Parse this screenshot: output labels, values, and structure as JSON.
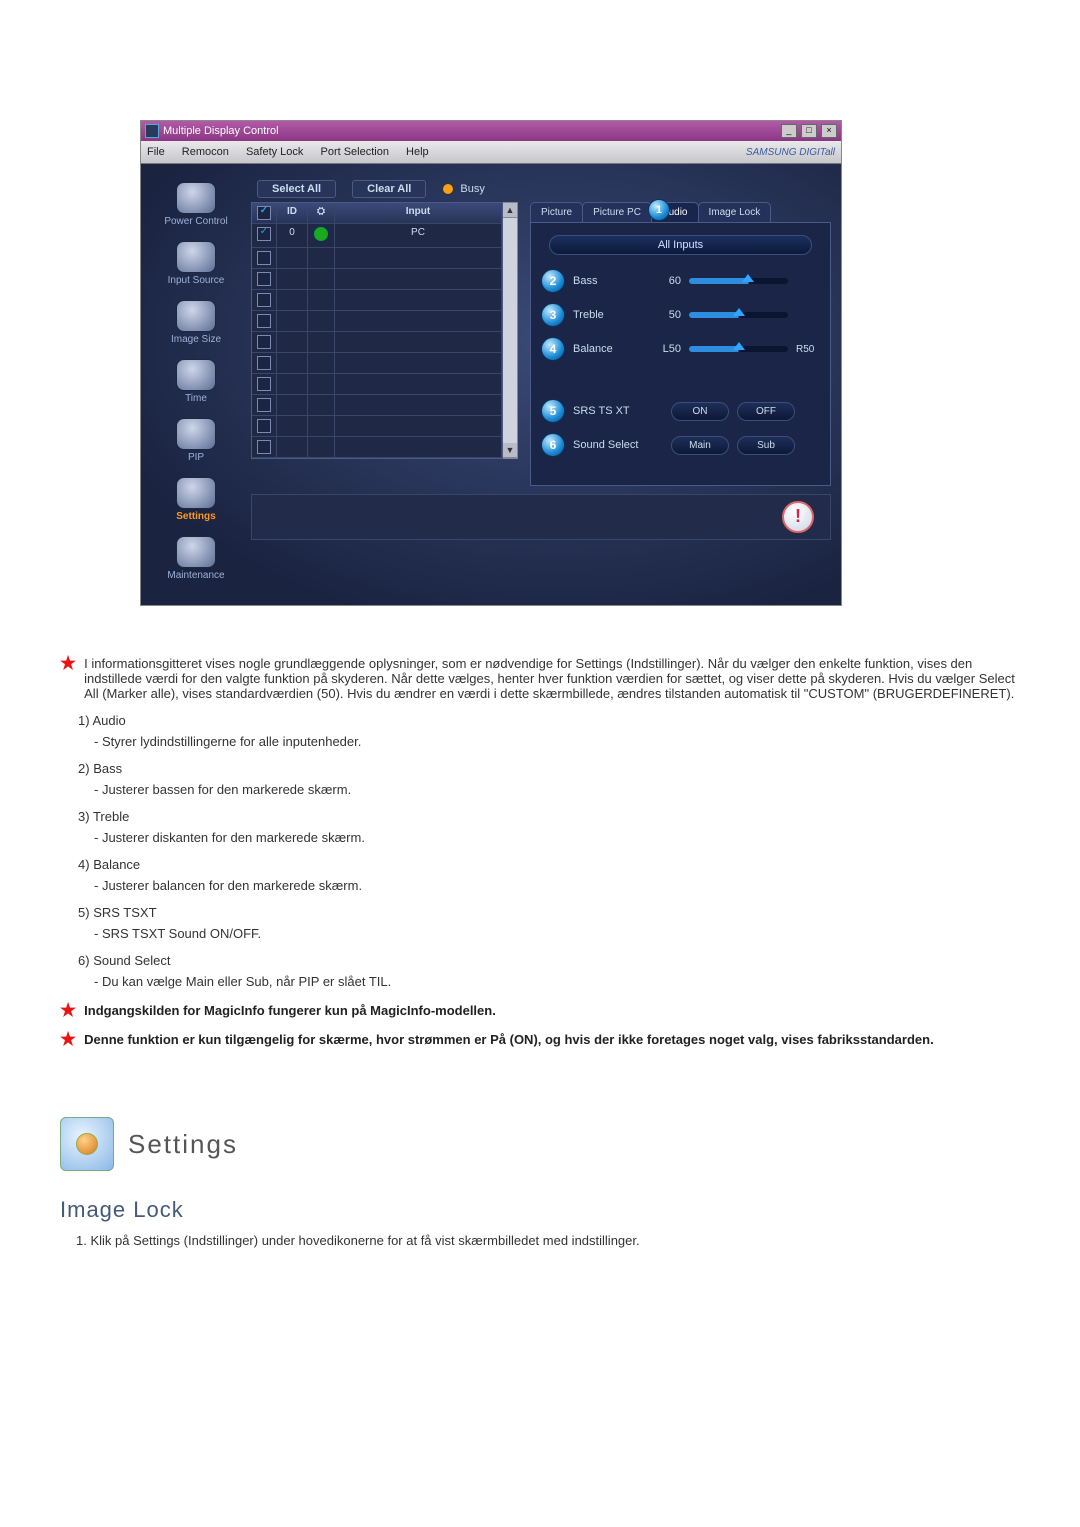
{
  "screenshot": {
    "window_title": "Multiple Display Control",
    "menu": [
      "File",
      "Remocon",
      "Safety Lock",
      "Port Selection",
      "Help"
    ],
    "brand": "SAMSUNG DIGITall",
    "sidebar": [
      {
        "label": "Power Control",
        "active": false
      },
      {
        "label": "Input Source",
        "active": false
      },
      {
        "label": "Image Size",
        "active": false
      },
      {
        "label": "Time",
        "active": false
      },
      {
        "label": "PIP",
        "active": false
      },
      {
        "label": "Settings",
        "active": true
      },
      {
        "label": "Maintenance",
        "active": false
      }
    ],
    "toolbar": {
      "select_all": "Select All",
      "clear_all": "Clear All",
      "busy": "Busy"
    },
    "grid": {
      "headers": {
        "id": "ID",
        "input": "Input"
      },
      "rows": [
        {
          "checked": true,
          "id": "0",
          "status": "on",
          "input": "PC"
        },
        {
          "checked": false
        },
        {
          "checked": false
        },
        {
          "checked": false
        },
        {
          "checked": false
        },
        {
          "checked": false
        },
        {
          "checked": false
        },
        {
          "checked": false
        },
        {
          "checked": false
        },
        {
          "checked": false
        },
        {
          "checked": false
        }
      ]
    },
    "tabs": [
      "Picture",
      "Picture PC",
      "Audio",
      "Image Lock"
    ],
    "tab_active": "Audio",
    "tab_badge": "1",
    "all_inputs": "All Inputs",
    "sliders": [
      {
        "num": "2",
        "label": "Bass",
        "value": "60",
        "percent": 60
      },
      {
        "num": "3",
        "label": "Treble",
        "value": "50",
        "percent": 50
      },
      {
        "num": "4",
        "label": "Balance",
        "value": "L50",
        "right": "R50",
        "percent": 50
      }
    ],
    "buttons": [
      {
        "num": "5",
        "label": "SRS TS XT",
        "a": "ON",
        "b": "OFF"
      },
      {
        "num": "6",
        "label": "Sound Select",
        "a": "Main",
        "b": "Sub"
      }
    ]
  },
  "doc": {
    "intro": "I informationsgitteret vises nogle grundlæggende oplysninger, som er nødvendige for Settings (Indstillinger). Når du vælger den enkelte funktion, vises den indstillede værdi for den valgte funktion på skyderen. Når dette vælges, henter hver funktion værdien for sættet, og viser dette på skyderen. Hvis du vælger Select All (Marker alle), vises standardværdien (50). Hvis du ændrer en værdi i dette skærmbillede, ændres tilstanden automatisk til \"CUSTOM\" (BRUGERDEFINERET).",
    "items": [
      {
        "n": "1)",
        "title": "Audio",
        "sub": "- Styrer lydindstillingerne for alle inputenheder."
      },
      {
        "n": "2)",
        "title": "Bass",
        "sub": "- Justerer bassen for den markerede skærm."
      },
      {
        "n": "3)",
        "title": "Treble",
        "sub": "- Justerer diskanten for den markerede skærm."
      },
      {
        "n": "4)",
        "title": "Balance",
        "sub": "- Justerer balancen for den markerede skærm."
      },
      {
        "n": "5)",
        "title": "SRS TSXT",
        "sub": "- SRS TSXT Sound ON/OFF."
      },
      {
        "n": "6)",
        "title": "Sound Select",
        "sub": "- Du kan vælge Main eller Sub, når PIP er slået TIL."
      }
    ],
    "note1": "Indgangskilden for MagicInfo fungerer kun på MagicInfo-modellen.",
    "note2": "Denne funktion er kun tilgængelig for skærme, hvor strømmen er På (ON), og hvis der ikke foretages noget valg, vises fabriksstandarden.",
    "section_title": "Settings",
    "sub_title": "Image Lock",
    "sub_step": "1. Klik på Settings (Indstillinger) under hovedikonerne for at få vist skærmbilledet med indstillinger."
  }
}
